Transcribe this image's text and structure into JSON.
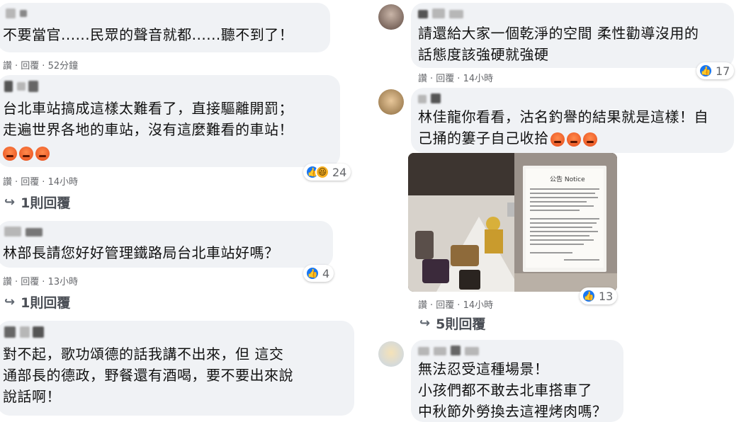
{
  "left_column": [
    {
      "text": "不要當官......民眾的聲音就都......聽不到了！",
      "meta": {
        "like": "讚",
        "reply": "回覆",
        "time": "52分鐘"
      }
    },
    {
      "text": "台北車站搞成這樣太難看了，直接驅離開罰；\n走遍世界各地的車站，沒有這麼難看的車站！",
      "reactions": {
        "icons": [
          "like-icon",
          "haha-icon"
        ],
        "count": "24"
      },
      "meta": {
        "like": "讚",
        "reply": "回覆",
        "time": "14小時"
      },
      "replies_link": "1則回覆"
    },
    {
      "text": "林部長請您好好管理鐵路局台北車站好嗎？",
      "reactions": {
        "icons": [
          "like-icon"
        ],
        "count": "4"
      },
      "meta": {
        "like": "讚",
        "reply": "回覆",
        "time": "13小時"
      },
      "replies_link": "1則回覆"
    },
    {
      "text": "對不起，歌功頌德的話我講不出來，但 這交\n通部長的德政，野餐還有酒喝，要不要出來說\n說話啊！"
    }
  ],
  "right_column": [
    {
      "text": "請還給大家一個乾淨的空間 柔性勸導沒用的\n話態度該強硬就強硬",
      "reactions": {
        "icons": [
          "like-icon"
        ],
        "count": "17"
      },
      "meta": {
        "like": "讚",
        "reply": "回覆",
        "time": "14小時"
      }
    },
    {
      "text": "林佳龍你看看，沽名釣譽的結果就是這樣！自\n己捅的簍子自己收拾",
      "photo": {
        "notice_title": "公告 Notice"
      },
      "reactions": {
        "icons": [
          "like-icon"
        ],
        "count": "13"
      },
      "meta": {
        "like": "讚",
        "reply": "回覆",
        "time": "14小時"
      },
      "replies_link": "5則回覆"
    },
    {
      "text": "無法忍受這種場景！\n小孩們都不敢去北車搭車了\n中秋節外勞換去這裡烤肉嗎？"
    }
  ],
  "colors": {
    "bubble": "#f0f2f5",
    "like_blue": "#1877f2",
    "meta_gray": "#65676b"
  }
}
